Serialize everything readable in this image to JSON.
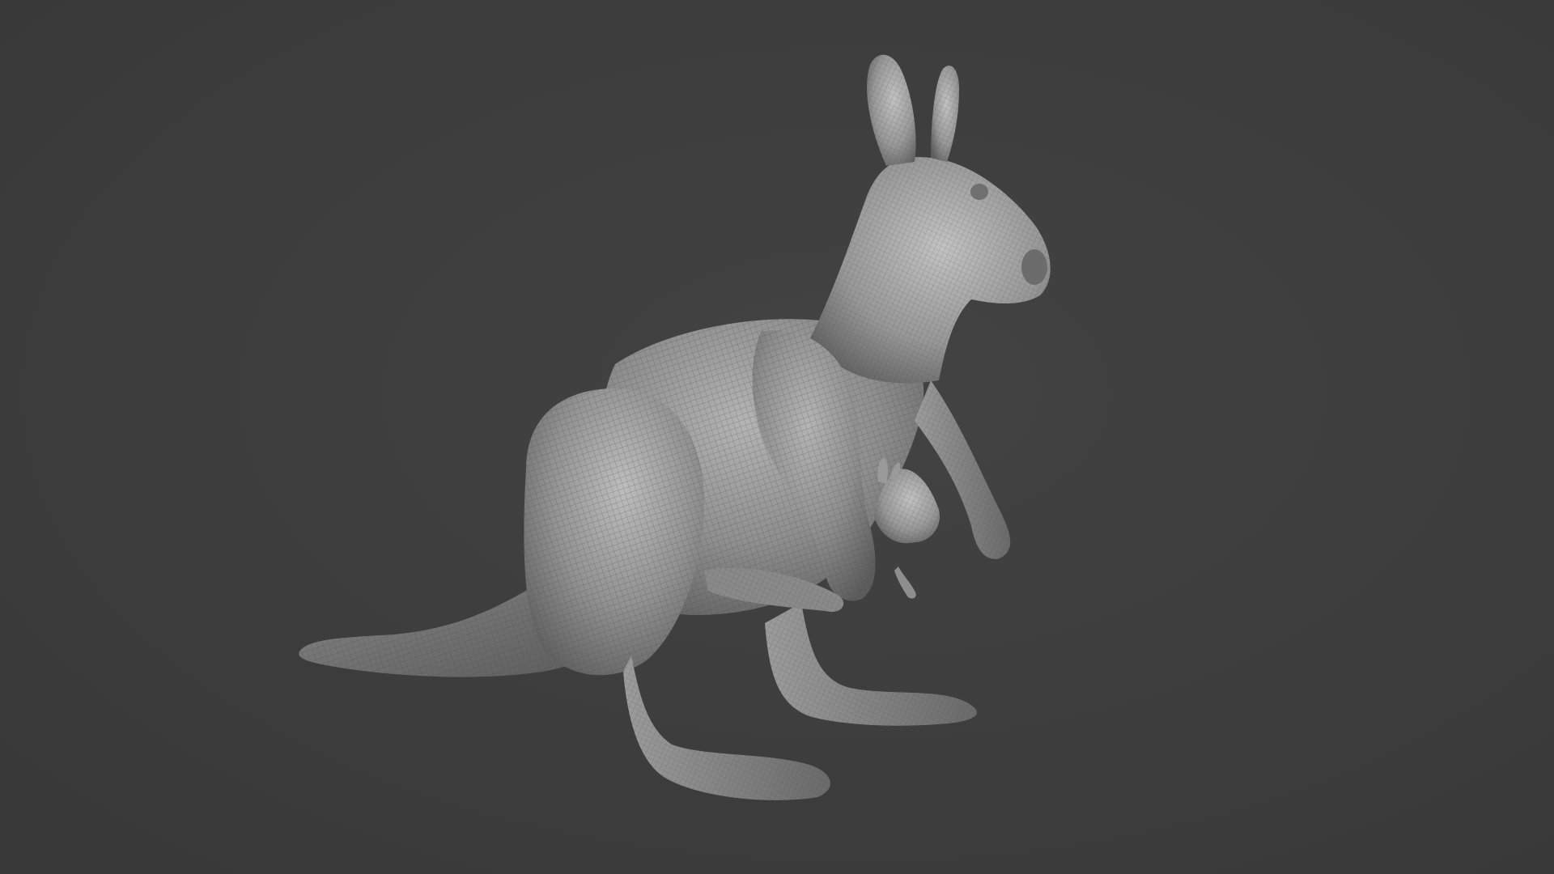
{
  "viewport": {
    "background_color": "#3d3d3d",
    "shading": "solid-with-wireframe"
  },
  "model": {
    "subject": "kangaroo-with-joey",
    "base_color": "#8c8c8c",
    "wire_color": "#5a5a5a"
  }
}
